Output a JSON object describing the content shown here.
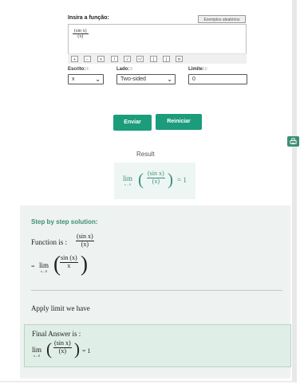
{
  "form": {
    "function_label": "Insira a função:",
    "examples_button": "Exemplos aleatórios",
    "function_numerator": "(sin x)",
    "function_denominator": "(x)",
    "toolbar": [
      "+",
      "−",
      "x",
      "/",
      "√",
      "ⁿ√",
      "(",
      ")",
      "π"
    ],
    "variable_label": "Escrito:",
    "variable_value": "x",
    "side_label": "Lado:",
    "side_value": "Two-sided",
    "limit_label": "Limite:",
    "limit_value": "0",
    "help_mark": "①"
  },
  "actions": {
    "submit": "Enviar",
    "reset": "Reiniciar",
    "print_icon": "print-icon"
  },
  "result": {
    "title": "Result",
    "lim_word": "lim",
    "lim_sub": "x→0",
    "numerator": "(sin x)",
    "denominator": "(x)",
    "equals": "= 1"
  },
  "steps": {
    "title": "Step by step solution:",
    "function_prefix": "Function is :",
    "function_numerator": "(sin x)",
    "function_denominator": "(x)",
    "eq_prefix": "=",
    "lim_word": "lim",
    "lim_sub": "x→0",
    "step2_numerator": "sin (x)",
    "step2_denominator": "x",
    "apply_text": "Apply limit we have",
    "final_label": "Final Answer is :",
    "final_numerator": "(sin x)",
    "final_denominator": "(x)",
    "final_equals": "= 1"
  },
  "colors": {
    "accent": "#1b9c7b",
    "math": "#3a8f80",
    "panel": "#eef2f0",
    "final_panel": "#dfeee6"
  }
}
